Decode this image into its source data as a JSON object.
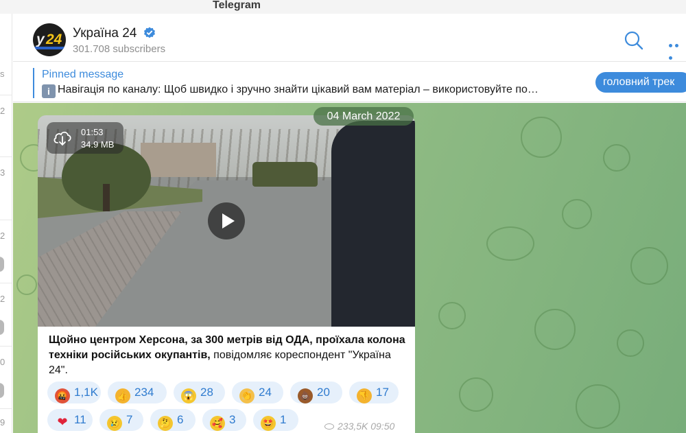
{
  "window": {
    "title": "Telegram"
  },
  "left_strip": {
    "numbers": [
      "s",
      "2",
      "3",
      "2",
      "2",
      "0",
      "9"
    ]
  },
  "channel": {
    "name": "Україна 24",
    "subscribers": "301.708 subscribers",
    "avatar": {
      "letter": "у",
      "number": "24"
    }
  },
  "pinned": {
    "title": "Pinned message",
    "text": "Навігація по каналу:  Щоб швидко і зручно знайти цікавий вам матеріал – використовуйте по…",
    "chip": "головний трек"
  },
  "date_divider": "04 March 2022",
  "video": {
    "duration": "01:53",
    "size": "34.9 MB"
  },
  "message": {
    "bold_text": "Щойно центром Херсона, за 300 метрів від ОДА, проїхала колона техніки російських окупантів,",
    "text": " повідомляє кореспондент \"Україна 24\"."
  },
  "reactions": [
    {
      "emoji": "angry-face-icon",
      "count": "1,1K"
    },
    {
      "emoji": "thumbs-up-icon",
      "count": "234"
    },
    {
      "emoji": "screaming-face-icon",
      "count": "28"
    },
    {
      "emoji": "clapping-hands-icon",
      "count": "24"
    },
    {
      "emoji": "poo-icon",
      "count": "20"
    },
    {
      "emoji": "thumbs-down-icon",
      "count": "17"
    },
    {
      "emoji": "red-heart-icon",
      "count": "11"
    },
    {
      "emoji": "crying-face-icon",
      "count": "7"
    },
    {
      "emoji": "thinking-face-icon",
      "count": "6"
    },
    {
      "emoji": "smiling-face-with-hearts-icon",
      "count": "3"
    },
    {
      "emoji": "star-struck-icon",
      "count": "1"
    }
  ],
  "meta": {
    "views": "233,5K",
    "time": "09:50"
  },
  "colors": {
    "accent": "#3d8bdc",
    "reaction_bg": "#e6f0fb",
    "chat_bg": "#93bd85"
  }
}
